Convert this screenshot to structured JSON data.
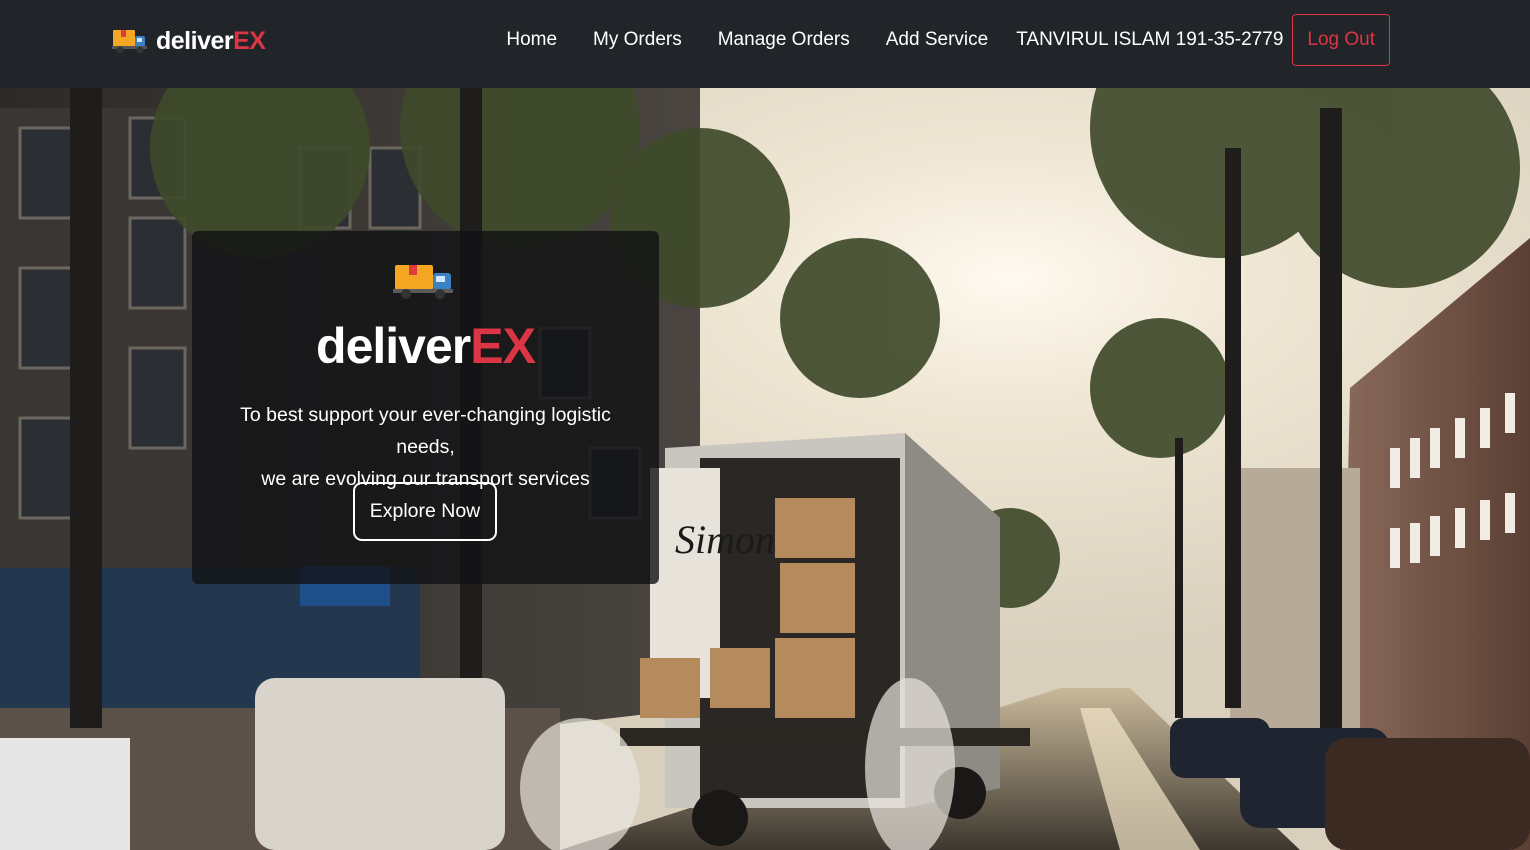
{
  "brand": {
    "name_main": "deliver",
    "name_accent": "EX",
    "logo_icon": "delivery-truck-icon"
  },
  "nav": {
    "links": [
      {
        "label": "Home"
      },
      {
        "label": "My Orders"
      },
      {
        "label": "Manage Orders"
      },
      {
        "label": "Add Service"
      }
    ],
    "user": "TANVIRUL ISLAM 191-35-2779",
    "logout_label": "Log Out"
  },
  "hero": {
    "background_image": "street-delivery-truck-photo",
    "title_main": "deliver",
    "title_accent": "EX",
    "tagline_line1": "To best support your ever-changing logistic needs,",
    "tagline_line2": "we are evolving our transport services",
    "cta_label": "Explore Now"
  },
  "colors": {
    "navbar_bg": "#212529",
    "accent": "#dc3545",
    "text": "#ffffff"
  }
}
